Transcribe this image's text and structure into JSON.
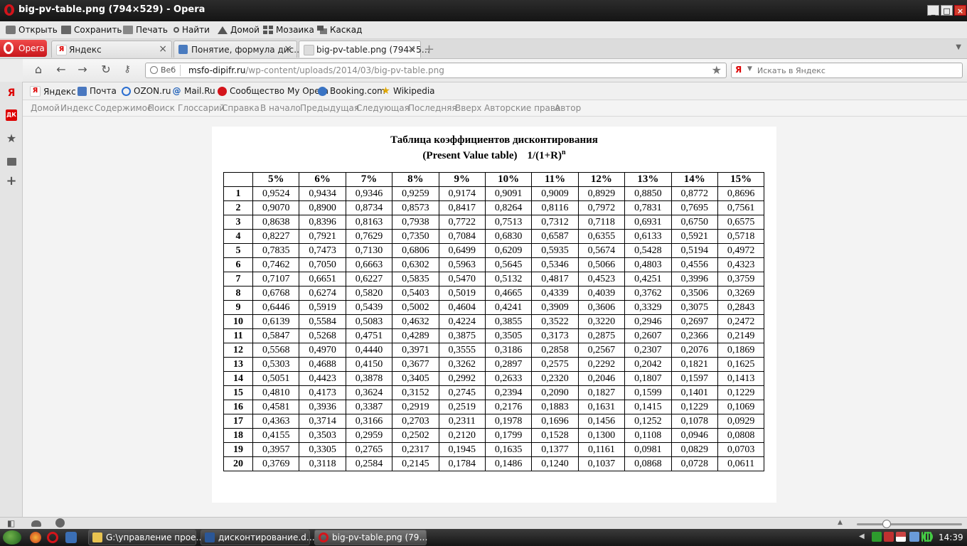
{
  "window": {
    "title": "big-pv-table.png (794×529) - Opera"
  },
  "menu": {
    "items": [
      {
        "label": "Открыть",
        "icon": "folder-icon"
      },
      {
        "label": "Сохранить",
        "icon": "save-icon"
      },
      {
        "label": "Печать",
        "icon": "printer-icon"
      },
      {
        "label": "Найти",
        "icon": "search-icon"
      },
      {
        "label": "Домой",
        "icon": "home-icon"
      },
      {
        "label": "Мозаика",
        "icon": "tile-icon"
      },
      {
        "label": "Каскад",
        "icon": "cascade-icon"
      }
    ]
  },
  "tabs": {
    "opera_label": "Opera",
    "items": [
      {
        "label": "Яндекс",
        "active": false
      },
      {
        "label": "Понятие, формула дис…",
        "active": false
      },
      {
        "label": "big-pv-table.png (794×5…",
        "active": true
      }
    ]
  },
  "address": {
    "web_label": "Веб",
    "url_domain": "msfo-dipifr.ru",
    "url_path": "/wp-content/uploads/2014/03/big-pv-table.png",
    "search_placeholder": "Искать в Яндекс"
  },
  "bookmarks": [
    {
      "label": "Яндекс",
      "icon": "yandex-icon"
    },
    {
      "label": "Почта",
      "icon": "mail-icon"
    },
    {
      "label": "OZON.ru",
      "icon": "ozon-icon"
    },
    {
      "label": "Mail.Ru",
      "icon": "mailru-icon"
    },
    {
      "label": "Сообщество My Opera",
      "icon": "opera-icon"
    },
    {
      "label": "Booking.com",
      "icon": "booking-icon"
    },
    {
      "label": "Wikipedia",
      "icon": "star-icon"
    }
  ],
  "navlinks": [
    "Домой",
    "Индекс",
    "Содержимое",
    "Поиск",
    "Глоссарий",
    "Справка",
    "В начало",
    "Предыдущая",
    "Следующая",
    "Последняя",
    "Вверх",
    "Авторские права",
    "Автор"
  ],
  "document": {
    "title_line1": "Таблица коэффициентов дисконтирования",
    "title_line2": "(Present Value table)",
    "formula": "1/(1+R)",
    "formula_exp": "n",
    "headers": [
      "5%",
      "6%",
      "7%",
      "8%",
      "9%",
      "10%",
      "11%",
      "12%",
      "13%",
      "14%",
      "15%"
    ],
    "rows": [
      [
        "1",
        "0,9524",
        "0,9434",
        "0,9346",
        "0,9259",
        "0,9174",
        "0,9091",
        "0,9009",
        "0,8929",
        "0,8850",
        "0,8772",
        "0,8696"
      ],
      [
        "2",
        "0,9070",
        "0,8900",
        "0,8734",
        "0,8573",
        "0,8417",
        "0,8264",
        "0,8116",
        "0,7972",
        "0,7831",
        "0,7695",
        "0,7561"
      ],
      [
        "3",
        "0,8638",
        "0,8396",
        "0,8163",
        "0,7938",
        "0,7722",
        "0,7513",
        "0,7312",
        "0,7118",
        "0,6931",
        "0,6750",
        "0,6575"
      ],
      [
        "4",
        "0,8227",
        "0,7921",
        "0,7629",
        "0,7350",
        "0,7084",
        "0,6830",
        "0,6587",
        "0,6355",
        "0,6133",
        "0,5921",
        "0,5718"
      ],
      [
        "5",
        "0,7835",
        "0,7473",
        "0,7130",
        "0,6806",
        "0,6499",
        "0,6209",
        "0,5935",
        "0,5674",
        "0,5428",
        "0,5194",
        "0,4972"
      ],
      [
        "6",
        "0,7462",
        "0,7050",
        "0,6663",
        "0,6302",
        "0,5963",
        "0,5645",
        "0,5346",
        "0,5066",
        "0,4803",
        "0,4556",
        "0,4323"
      ],
      [
        "7",
        "0,7107",
        "0,6651",
        "0,6227",
        "0,5835",
        "0,5470",
        "0,5132",
        "0,4817",
        "0,4523",
        "0,4251",
        "0,3996",
        "0,3759"
      ],
      [
        "8",
        "0,6768",
        "0,6274",
        "0,5820",
        "0,5403",
        "0,5019",
        "0,4665",
        "0,4339",
        "0,4039",
        "0,3762",
        "0,3506",
        "0,3269"
      ],
      [
        "9",
        "0,6446",
        "0,5919",
        "0,5439",
        "0,5002",
        "0,4604",
        "0,4241",
        "0,3909",
        "0,3606",
        "0,3329",
        "0,3075",
        "0,2843"
      ],
      [
        "10",
        "0,6139",
        "0,5584",
        "0,5083",
        "0,4632",
        "0,4224",
        "0,3855",
        "0,3522",
        "0,3220",
        "0,2946",
        "0,2697",
        "0,2472"
      ],
      [
        "11",
        "0,5847",
        "0,5268",
        "0,4751",
        "0,4289",
        "0,3875",
        "0,3505",
        "0,3173",
        "0,2875",
        "0,2607",
        "0,2366",
        "0,2149"
      ],
      [
        "12",
        "0,5568",
        "0,4970",
        "0,4440",
        "0,3971",
        "0,3555",
        "0,3186",
        "0,2858",
        "0,2567",
        "0,2307",
        "0,2076",
        "0,1869"
      ],
      [
        "13",
        "0,5303",
        "0,4688",
        "0,4150",
        "0,3677",
        "0,3262",
        "0,2897",
        "0,2575",
        "0,2292",
        "0,2042",
        "0,1821",
        "0,1625"
      ],
      [
        "14",
        "0,5051",
        "0,4423",
        "0,3878",
        "0,3405",
        "0,2992",
        "0,2633",
        "0,2320",
        "0,2046",
        "0,1807",
        "0,1597",
        "0,1413"
      ],
      [
        "15",
        "0,4810",
        "0,4173",
        "0,3624",
        "0,3152",
        "0,2745",
        "0,2394",
        "0,2090",
        "0,1827",
        "0,1599",
        "0,1401",
        "0,1229"
      ],
      [
        "16",
        "0,4581",
        "0,3936",
        "0,3387",
        "0,2919",
        "0,2519",
        "0,2176",
        "0,1883",
        "0,1631",
        "0,1415",
        "0,1229",
        "0,1069"
      ],
      [
        "17",
        "0,4363",
        "0,3714",
        "0,3166",
        "0,2703",
        "0,2311",
        "0,1978",
        "0,1696",
        "0,1456",
        "0,1252",
        "0,1078",
        "0,0929"
      ],
      [
        "18",
        "0,4155",
        "0,3503",
        "0,2959",
        "0,2502",
        "0,2120",
        "0,1799",
        "0,1528",
        "0,1300",
        "0,1108",
        "0,0946",
        "0,0808"
      ],
      [
        "19",
        "0,3957",
        "0,3305",
        "0,2765",
        "0,2317",
        "0,1945",
        "0,1635",
        "0,1377",
        "0,1161",
        "0,0981",
        "0,0829",
        "0,0703"
      ],
      [
        "20",
        "0,3769",
        "0,3118",
        "0,2584",
        "0,2145",
        "0,1784",
        "0,1486",
        "0,1240",
        "0,1037",
        "0,0868",
        "0,0728",
        "0,0611"
      ]
    ]
  },
  "taskbar": {
    "tasks": [
      {
        "label": "G:\\управление прое…",
        "icon": "folder-icon",
        "active": false
      },
      {
        "label": "дисконтирование.d…",
        "icon": "word-icon",
        "active": false
      },
      {
        "label": "big-pv-table.png (79…",
        "icon": "opera-icon",
        "active": true
      }
    ],
    "clock": "14:39"
  },
  "colors": {
    "opera_red": "#d4141b",
    "yandex_red": "#dd0000"
  }
}
